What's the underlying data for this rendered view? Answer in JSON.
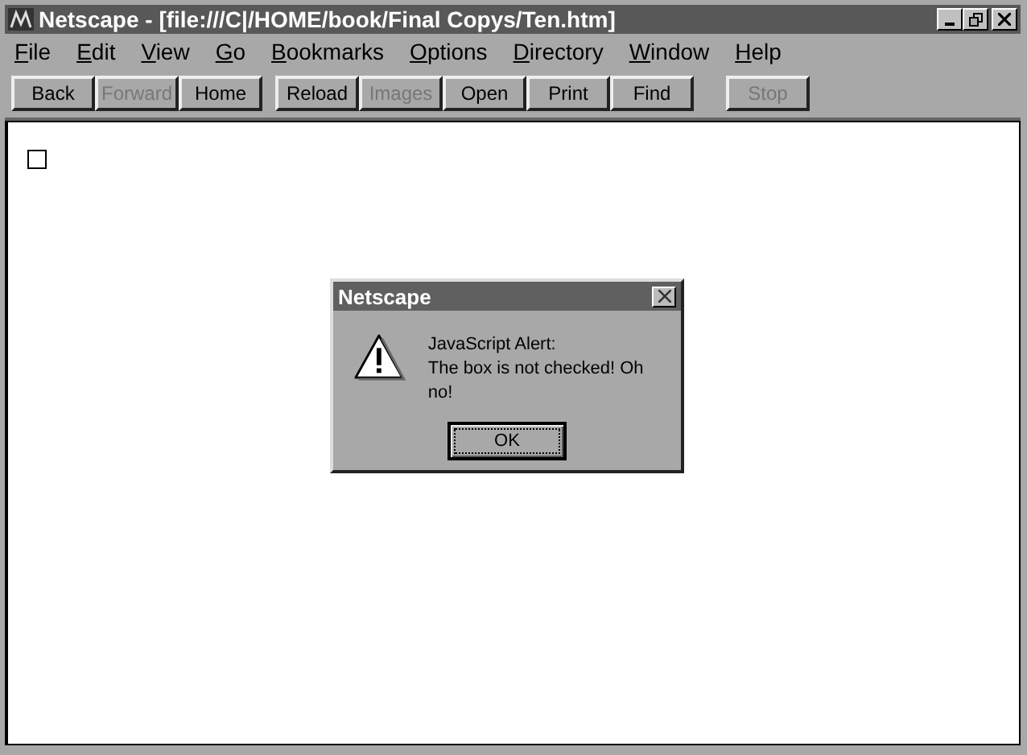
{
  "window": {
    "title": "Netscape - [file:///C|/HOME/book/Final Copys/Ten.htm]"
  },
  "menu": [
    "File",
    "Edit",
    "View",
    "Go",
    "Bookmarks",
    "Options",
    "Directory",
    "Window",
    "Help"
  ],
  "toolbar": [
    [
      {
        "label": "Back",
        "disabled": false
      },
      {
        "label": "Forward",
        "disabled": true
      },
      {
        "label": "Home",
        "disabled": false
      }
    ],
    [
      {
        "label": "Reload",
        "disabled": false
      },
      {
        "label": "Images",
        "disabled": true
      },
      {
        "label": "Open",
        "disabled": false
      },
      {
        "label": "Print",
        "disabled": false
      },
      {
        "label": "Find",
        "disabled": false
      }
    ],
    [
      {
        "label": "Stop",
        "disabled": true
      }
    ]
  ],
  "page": {
    "checkbox": {
      "checked": false
    }
  },
  "dialog": {
    "title": "Netscape",
    "lines": [
      "JavaScript Alert:",
      "The box is not checked! Oh no!"
    ],
    "button": "OK"
  }
}
